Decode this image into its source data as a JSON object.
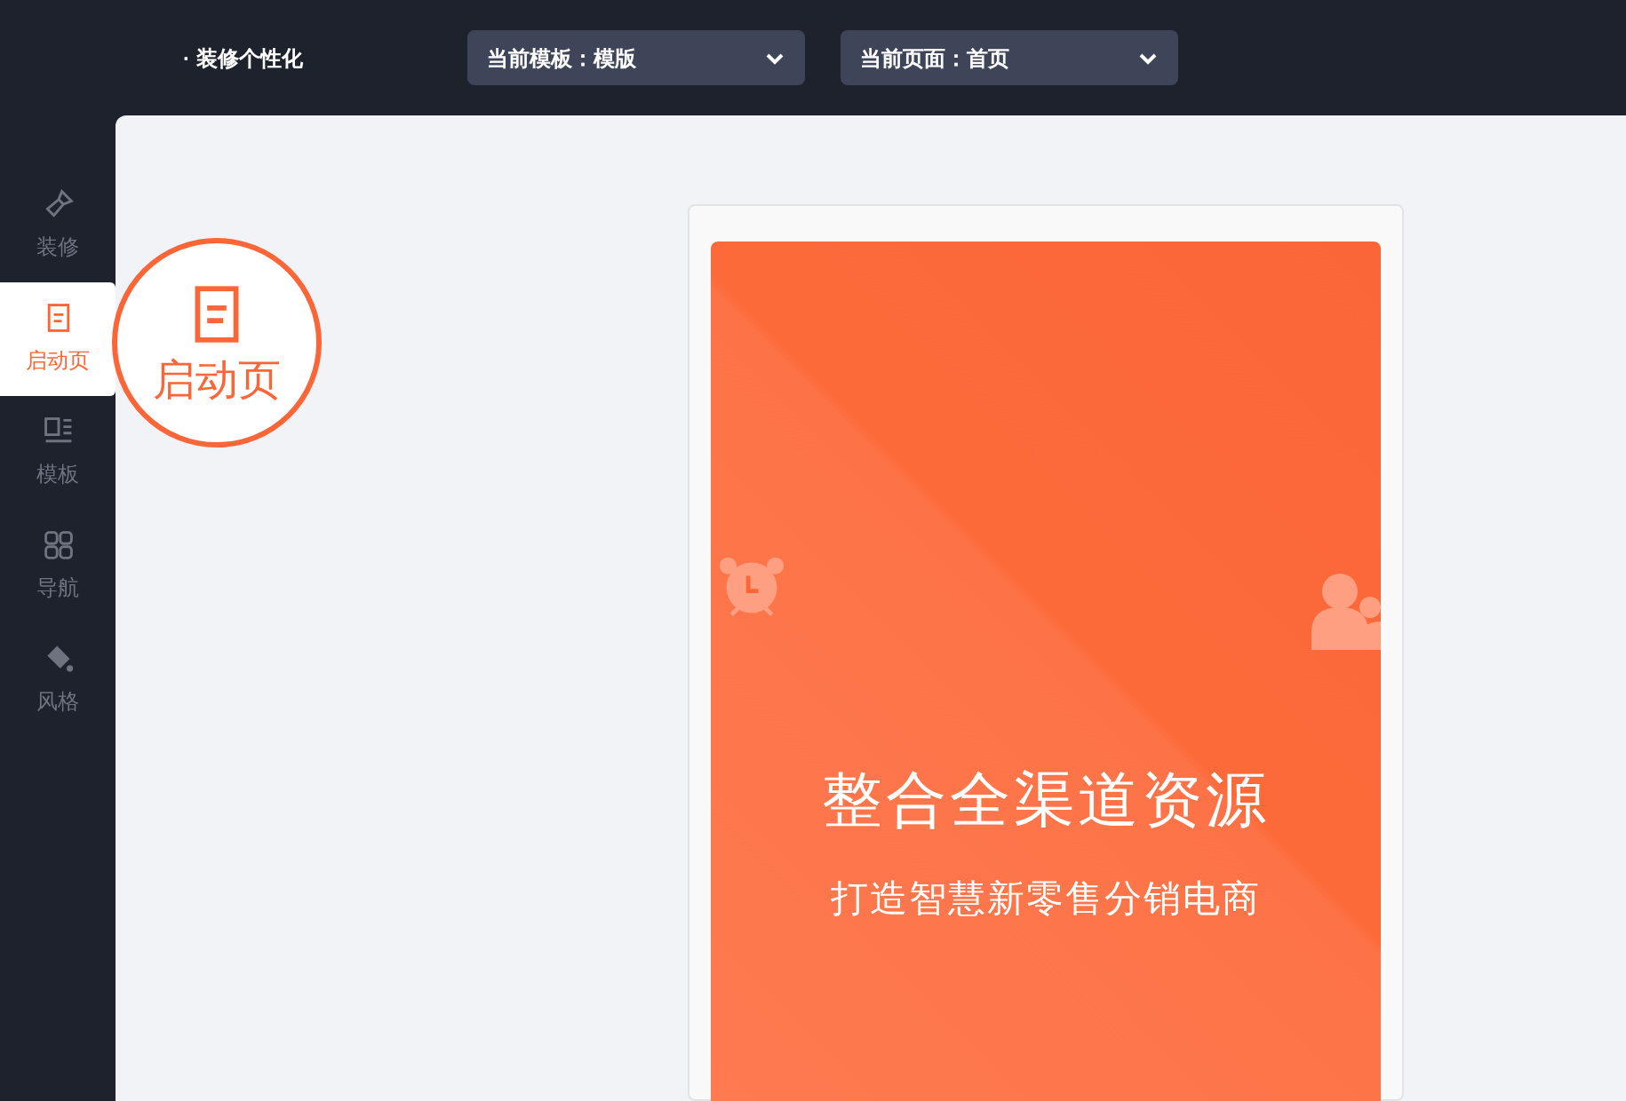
{
  "header": {
    "title": "· 装修个性化",
    "dropdowns": [
      {
        "label": "当前模板：模版"
      },
      {
        "label": "当前页面：首页"
      }
    ]
  },
  "sidebar": {
    "items": [
      {
        "kind": "brush",
        "label": "装修",
        "selected": false
      },
      {
        "kind": "page",
        "label": "启动页",
        "selected": true
      },
      {
        "kind": "template",
        "label": "模板",
        "selected": false
      },
      {
        "kind": "grid",
        "label": "导航",
        "selected": false
      },
      {
        "kind": "bucket",
        "label": "风格",
        "selected": false
      }
    ]
  },
  "callout": {
    "label": "启动页"
  },
  "splash": {
    "headline": "整合全渠道资源",
    "subline": "打造智慧新零售分销电商"
  }
}
